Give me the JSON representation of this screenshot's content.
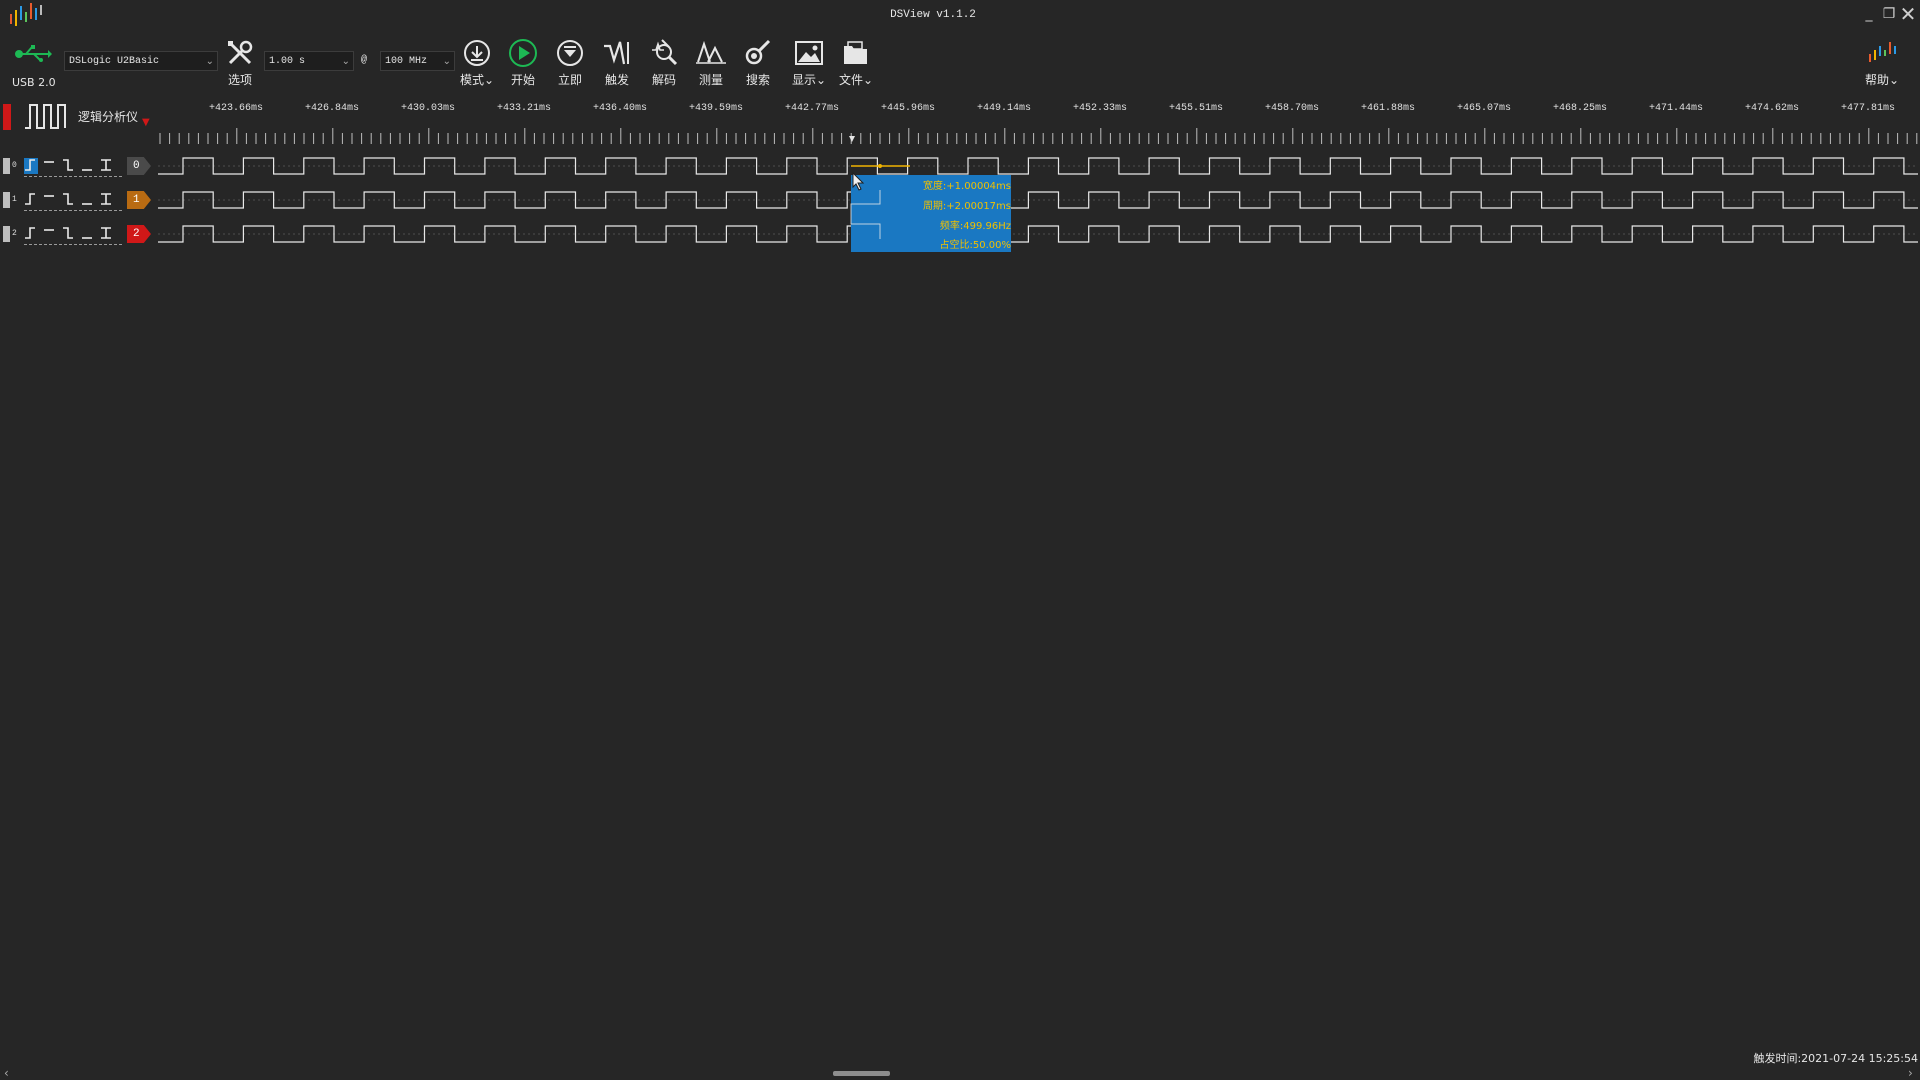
{
  "window": {
    "title": "DSView v1.1.2"
  },
  "toolbar": {
    "usb_label": "USB 2.0",
    "device": "DSLogic U2Basic",
    "options_label": "选项",
    "duration": "1.00 s",
    "at_symbol": "@",
    "samplerate": "100 MHz",
    "mode_label": "模式",
    "start_label": "开始",
    "instant_label": "立即",
    "trigger_label": "触发",
    "decode_label": "解码",
    "measure_label": "测量",
    "search_label": "搜索",
    "display_label": "显示",
    "file_label": "文件",
    "help_label": "帮助"
  },
  "analyzer": {
    "mode_name": "逻辑分析仪"
  },
  "ruler": {
    "ticks": [
      "+423.66ms",
      "+426.84ms",
      "+430.03ms",
      "+433.21ms",
      "+436.40ms",
      "+439.59ms",
      "+442.77ms",
      "+445.96ms",
      "+449.14ms",
      "+452.33ms",
      "+455.51ms",
      "+458.70ms",
      "+461.88ms",
      "+465.07ms",
      "+468.25ms",
      "+471.44ms",
      "+474.62ms",
      "+477.81ms"
    ]
  },
  "channels": [
    {
      "index": "0",
      "badge": "0",
      "color": "#4a4a4a"
    },
    {
      "index": "1",
      "badge": "1",
      "color": "#b96b12"
    },
    {
      "index": "2",
      "badge": "2",
      "color": "#d01818"
    }
  ],
  "signal": {
    "period_ms": 2.00017,
    "duty_percent": 50
  },
  "measurement": {
    "width": "宽度:+1.00004ms",
    "period": "周期:+2.00017ms",
    "frequency": "频率:499.96Hz",
    "duty": "占空比:50.00%"
  },
  "status": {
    "trigger_time": "触发时间:2021-07-24 15:25:54"
  },
  "colors": {
    "background": "#262626",
    "accent_green": "#1db954",
    "popup_blue": "#1a78c2",
    "popup_text": "#f0c000",
    "run_red": "#d01818"
  }
}
